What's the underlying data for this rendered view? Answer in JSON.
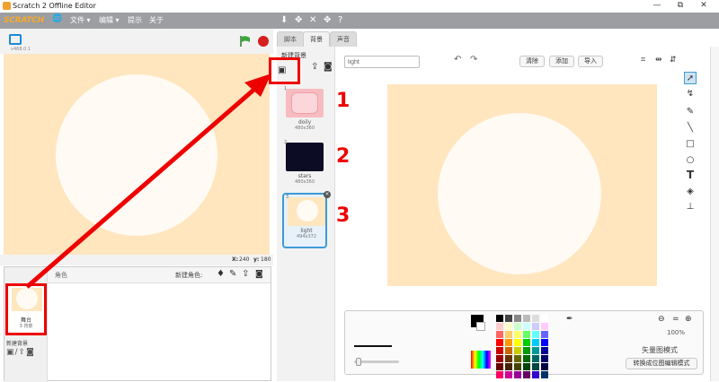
{
  "window": {
    "title": "Scratch 2 Offline Editor",
    "min": "—",
    "max": "⧉",
    "close": "✕"
  },
  "menu": {
    "logo": "SCRATCH",
    "globe": "🌐",
    "file": "文件 ▾",
    "edit": "编辑 ▾",
    "tips": "提示",
    "about": "关于"
  },
  "toolbar_icons": [
    "⬇",
    "✥",
    "✕",
    "✥",
    "?"
  ],
  "stage": {
    "version": "v468.0.1",
    "coord_x_label": "X:",
    "coord_x": "240",
    "coord_y_label": "y:",
    "coord_y": "180"
  },
  "sprites": {
    "header": "角色",
    "new_sprite_label": "新建角色:",
    "stage_label": "舞台",
    "stage_count": "3 背景",
    "new_backdrop_label": "新建背景"
  },
  "tabs": [
    "脚本",
    "背景",
    "声音"
  ],
  "costumes": {
    "header": "新建背景",
    "items": [
      {
        "num": "1",
        "name": "doily",
        "size": "480x360"
      },
      {
        "num": "2",
        "name": "stars",
        "size": "480x360"
      },
      {
        "num": "3",
        "name": "light",
        "size": "494x372"
      }
    ]
  },
  "editor": {
    "name_value": "light",
    "clear": "清除",
    "add": "添加",
    "import": "导入",
    "zoom": "100%",
    "mode": "矢量图模式",
    "convert": "转换成位图编辑模式"
  },
  "annotations": [
    "1",
    "2",
    "3"
  ],
  "colors": {
    "stage_bg": "#ffe6bf",
    "circle": "#fffaf3",
    "highlight": "#e00000",
    "menubar": "#9c9ea2",
    "selected": "#3d9ad6"
  }
}
